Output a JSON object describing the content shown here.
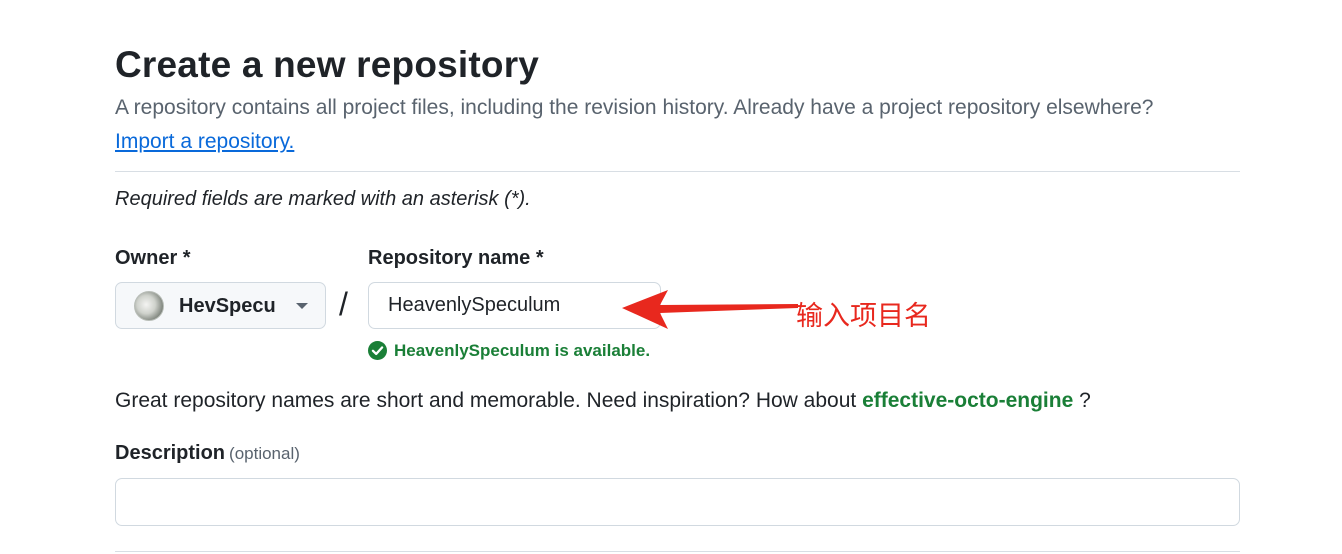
{
  "header": {
    "title": "Create a new repository",
    "subtitle": "A repository contains all project files, including the revision history. Already have a project repository elsewhere?",
    "import_link": "Import a repository."
  },
  "form": {
    "required_note": "Required fields are marked with an asterisk (*).",
    "owner": {
      "label": "Owner *",
      "value": "HevSpecu",
      "avatar_icon": "user-avatar",
      "dropdown_icon": "triangle-down-icon"
    },
    "separator": "/",
    "repo_name": {
      "label": "Repository name *",
      "value": "HeavenlySpeculum",
      "availability": "HeavenlySpeculum is available.",
      "status_icon": "check-circle-fill-icon",
      "status_color": "#1a7f37"
    },
    "suggestion": {
      "prefix": "Great repository names are short and memorable. Need inspiration? How about ",
      "name": "effective-octo-engine",
      "suffix": " ?"
    },
    "description": {
      "label": "Description",
      "optional_tag": "(optional)",
      "value": ""
    }
  },
  "annotation": {
    "text": "输入项目名",
    "color": "#e8281e",
    "icon": "red-arrow-left-icon"
  },
  "colors": {
    "link": "#0969da",
    "success": "#1a7f37",
    "muted": "#59636e",
    "border": "#d1d9e0"
  }
}
